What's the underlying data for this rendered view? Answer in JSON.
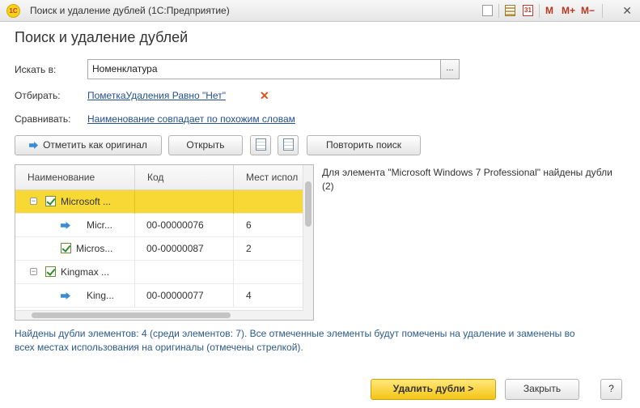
{
  "window": {
    "logo": "1С",
    "title": "Поиск и удаление дублей  (1С:Предприятие)",
    "toolbar": {
      "memory_m": "M",
      "memory_m_plus": "M+",
      "memory_m_minus": "M−",
      "close": "✕",
      "icons": [
        "favorite-icon",
        "calculator-icon",
        "calendar-icon"
      ],
      "calendar_text": "31"
    }
  },
  "form": {
    "title": "Поиск и удаление дублей",
    "search_in": {
      "label": "Искать в:",
      "value": "Номенклатура",
      "button": "..."
    },
    "filter": {
      "label": "Отбирать:",
      "value": "ПометкаУдаления Равно \"Нет\""
    },
    "compare": {
      "label": "Сравнивать:",
      "value": "Наименование совпадает по похожим словам"
    },
    "buttons": {
      "mark_original": "Отметить как оригинал",
      "open": "Открыть",
      "repeat_search": "Повторить поиск",
      "delete_duplicates": "Удалить дубли >",
      "close": "Закрыть",
      "help": "?"
    },
    "table": {
      "columns": [
        "Наименование",
        "Код",
        "Мест испол"
      ],
      "rows": [
        {
          "level": 0,
          "toggle": "−",
          "checked": true,
          "selected": true,
          "name": "Microsoft ...",
          "code": "",
          "places": ""
        },
        {
          "level": 1,
          "original": true,
          "name": "Micr...",
          "code": "00-00000076",
          "places": "6"
        },
        {
          "level": 1,
          "checked": true,
          "name": "Micros...",
          "code": "00-00000087",
          "places": "2"
        },
        {
          "level": 0,
          "toggle": "−",
          "checked": true,
          "name": "Kingmax ...",
          "code": "",
          "places": ""
        },
        {
          "level": 1,
          "original": true,
          "name": "King...",
          "code": "00-00000077",
          "places": "4"
        }
      ]
    },
    "info": "Для элемента \"Microsoft Windows 7 Professional\" найдены дубли (2)",
    "status": "Найдены дубли элементов: 4 (среди элементов: 7). Все отмеченные элементы будут помечены на удаление и заменены во всех местах использования на оригиналы (отмечены стрелкой)."
  },
  "colors": {
    "selected_row": "#f8d835",
    "link": "#23508f",
    "primary_button": "#f5c518",
    "status_text": "#2c5a8c"
  }
}
